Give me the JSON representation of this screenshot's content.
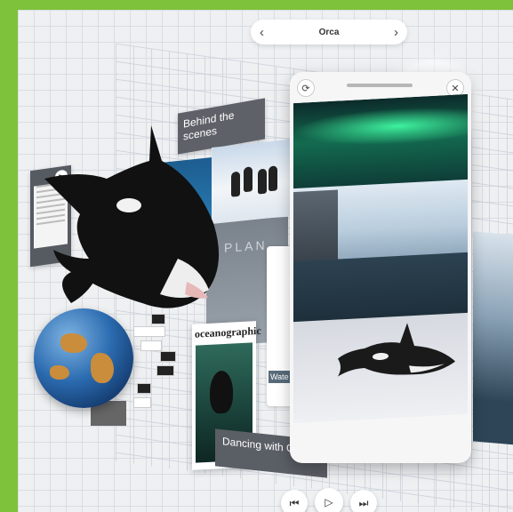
{
  "nav": {
    "title": "Orca",
    "prev_icon": "chevron-left-icon",
    "next_icon": "chevron-right-icon"
  },
  "panels": {
    "behind_scenes": {
      "small": "",
      "title": "Behind the scenes"
    },
    "planet_text": "PLAN",
    "water_label": "Wate",
    "magazine_brand": "oceanographic",
    "dancing": {
      "small": "",
      "title": "Dancing with Orcas"
    }
  },
  "phone": {
    "refresh_icon": "refresh-icon",
    "close_icon": "close-icon"
  },
  "controls": {
    "prev_icon": "skip-previous-icon",
    "play_icon": "play-icon",
    "next_icon": "skip-next-icon"
  },
  "colors": {
    "frame": "#7dc23a",
    "panel": "#5e6168",
    "aurora": "#3ef29e"
  }
}
